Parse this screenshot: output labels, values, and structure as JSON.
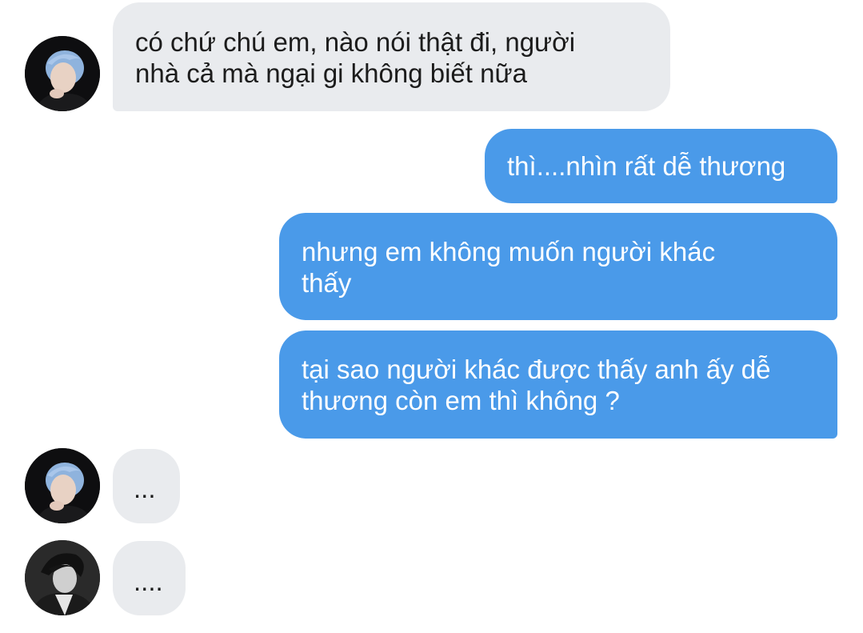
{
  "conversation": {
    "messages": [
      {
        "sender": "other",
        "avatar": "avatar-photo-blue-hair",
        "text": "có chứ chú em, nào nói thật đi, người\nnhà cả mà ngại gi không biết nữa"
      },
      {
        "sender": "me",
        "text": "thì....nhìn rất dễ thương"
      },
      {
        "sender": "me",
        "text": "nhưng em không muốn người khác\nthấy"
      },
      {
        "sender": "me",
        "text": "tại sao người khác được thấy anh ấy dễ\nthương còn em thì không ?"
      },
      {
        "sender": "other",
        "avatar": "avatar-photo-blue-hair",
        "text": "..."
      },
      {
        "sender": "other",
        "avatar": "avatar-photo-black-white",
        "text": "...."
      }
    ]
  },
  "colors": {
    "incoming_bubble": "#e9ebee",
    "outgoing_bubble": "#4a9ae9",
    "incoming_text": "#1c1c1c",
    "outgoing_text": "#ffffff"
  }
}
